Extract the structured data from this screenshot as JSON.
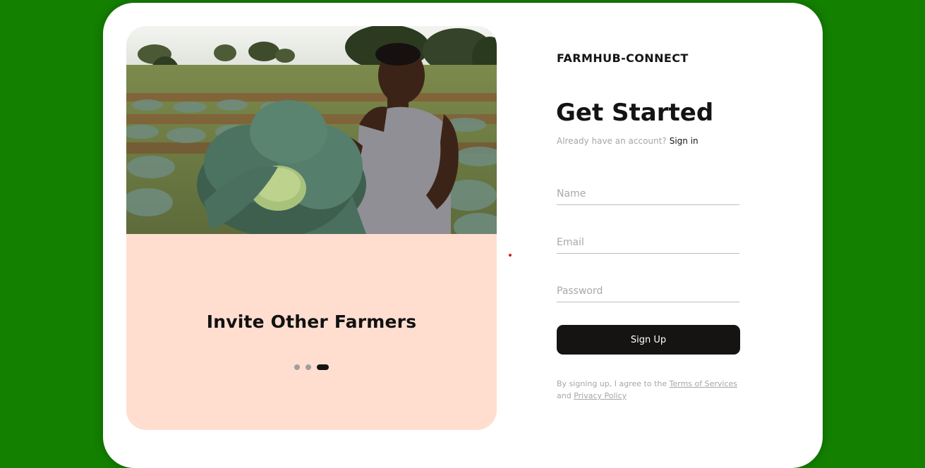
{
  "brand": {
    "name": "FARMHUB-CONNECT"
  },
  "signup": {
    "heading": "Get Started",
    "account_prompt": "Already have an account?",
    "signin_link": "Sign in",
    "fields": {
      "name_placeholder": "Name",
      "email_placeholder": "Email",
      "password_placeholder": "Password"
    },
    "submit_label": "Sign Up",
    "terms": {
      "prefix": "By signing up, I agree to the",
      "terms_link": "Terms of Services",
      "conjunction": "and",
      "privacy_link": "Privacy Policy"
    }
  },
  "carousel": {
    "slide_title": "Invite Other Farmers",
    "slide_count": 3,
    "active_index": 2,
    "image_icon": "farmer-with-cabbage-photo"
  },
  "colors": {
    "page_background": "#138000",
    "panel_background": "#ffded0",
    "button_background": "#161313",
    "muted_text": "#a6a6a6"
  }
}
